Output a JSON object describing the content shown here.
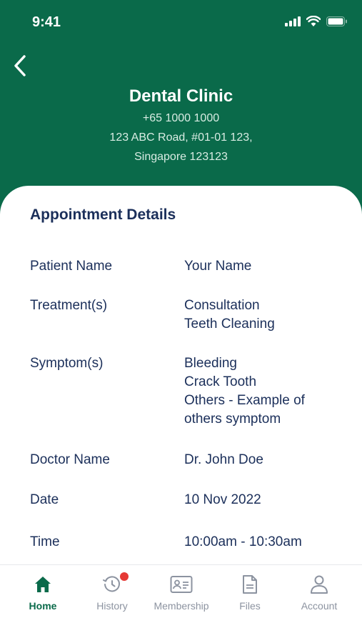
{
  "status_bar": {
    "time": "9:41"
  },
  "clinic": {
    "name": "Dental Clinic",
    "phone": "+65 1000 1000",
    "address_line1": "123 ABC Road, #01-01 123,",
    "address_line2": "Singapore 123123"
  },
  "appointment": {
    "title": "Appointment Details",
    "patient": {
      "label": "Patient Name",
      "value": "Your Name"
    },
    "treatments": {
      "label": "Treatment(s)",
      "values": [
        "Consultation",
        "Teeth Cleaning"
      ]
    },
    "symptoms": {
      "label": "Symptom(s)",
      "values": [
        "Bleeding",
        "Crack Tooth",
        "Others - Example of",
        "others symptom"
      ]
    },
    "doctor": {
      "label": "Doctor Name",
      "value": "Dr. John Doe"
    },
    "date": {
      "label": "Date",
      "value": "10 Nov 2022"
    },
    "time": {
      "label": "Time",
      "value": "10:00am - 10:30am"
    }
  },
  "tabs": [
    {
      "label": "Home",
      "icon": "home-icon",
      "active": true
    },
    {
      "label": "History",
      "icon": "history-icon",
      "active": false
    },
    {
      "label": "Membership",
      "icon": "membership-card-icon",
      "active": false
    },
    {
      "label": "Files",
      "icon": "file-icon",
      "active": false
    },
    {
      "label": "Account",
      "icon": "account-icon",
      "active": false
    }
  ],
  "colors": {
    "brand_green": "#0a6a4a",
    "text_navy": "#1b2f5a",
    "inactive_gray": "#8c93a0",
    "notification_red": "#e53935"
  }
}
